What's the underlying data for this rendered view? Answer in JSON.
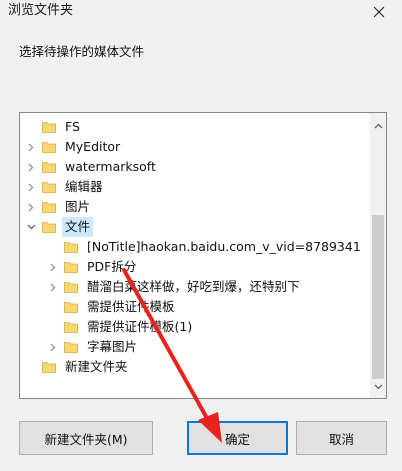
{
  "dialog": {
    "title": "浏览文件夹",
    "prompt": "选择待操作的媒体文件"
  },
  "tree": {
    "items": [
      {
        "label": "FS",
        "expander": "none",
        "selected": false
      },
      {
        "label": "MyEditor",
        "expander": "collapsed",
        "selected": false
      },
      {
        "label": "watermarksoft",
        "expander": "collapsed",
        "selected": false
      },
      {
        "label": "编辑器",
        "expander": "collapsed",
        "selected": false
      },
      {
        "label": "图片",
        "expander": "collapsed",
        "selected": false
      },
      {
        "label": "文件",
        "expander": "expanded",
        "selected": true
      },
      {
        "label": "[NoTitle]haokan.baidu.com_v_vid=8789341",
        "expander": "none",
        "selected": false
      },
      {
        "label": "PDF拆分",
        "expander": "collapsed",
        "selected": false
      },
      {
        "label": "醋溜白菜这样做，好吃到爆，还特别下",
        "expander": "collapsed",
        "selected": false
      },
      {
        "label": "需提供证件模板",
        "expander": "none",
        "selected": false
      },
      {
        "label": "需提供证件模板(1)",
        "expander": "none",
        "selected": false
      },
      {
        "label": "字幕图片",
        "expander": "collapsed",
        "selected": false
      },
      {
        "label": "新建文件夹",
        "expander": "none",
        "selected": false
      }
    ]
  },
  "buttons": {
    "new_folder": "新建文件夹(M)",
    "ok": "确定",
    "cancel": "取消"
  },
  "colors": {
    "folder": "#f7d674",
    "selection": "#cce8ff",
    "default_button_border": "#0078d7",
    "arrow": "#e8231b"
  },
  "icons": {
    "close": "close-icon",
    "folder": "folder-icon",
    "expand": "chevron-right-icon",
    "collapse": "chevron-down-icon",
    "scroll_up": "scroll-up-arrow-icon",
    "scroll_down": "scroll-down-arrow-icon"
  }
}
